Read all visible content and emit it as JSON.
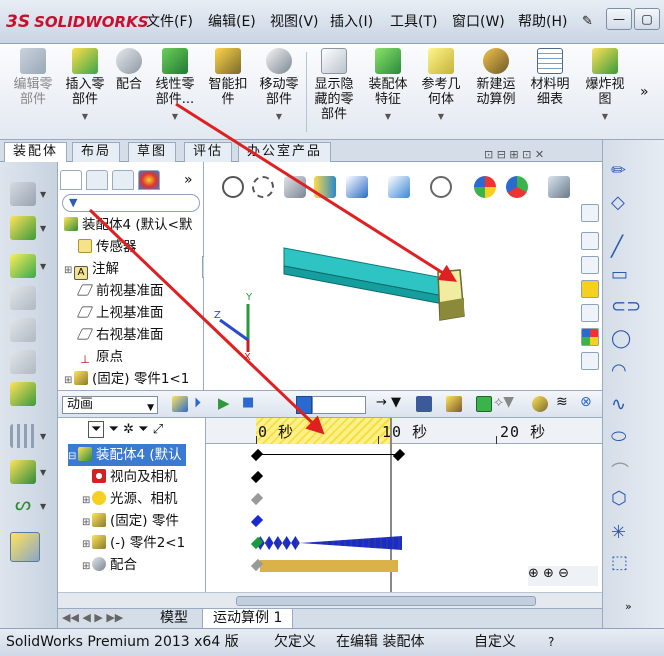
{
  "app": {
    "logo_prefix": "3S",
    "logo_text": "SOLIDWORKS"
  },
  "menu": {
    "items": [
      "文件(F)",
      "编辑(E)",
      "视图(V)",
      "插入(I)",
      "工具(T)",
      "窗口(W)",
      "帮助(H)"
    ]
  },
  "ribbon": {
    "buttons": [
      {
        "label": "编辑零\n部件",
        "icon": "edit-component-icon"
      },
      {
        "label": "插入零\n部件",
        "icon": "insert-component-icon"
      },
      {
        "label": "配合",
        "icon": "mate-icon"
      },
      {
        "label": "线性零\n部件...",
        "icon": "linear-pattern-icon"
      },
      {
        "label": "智能扣\n件",
        "icon": "smart-fastener-icon"
      },
      {
        "label": "移动零\n部件",
        "icon": "move-component-icon"
      },
      {
        "label": "显示隐\n藏的零\n部件",
        "icon": "show-hidden-icon"
      },
      {
        "label": "装配体\n特征",
        "icon": "assembly-feature-icon"
      },
      {
        "label": "参考几\n何体",
        "icon": "reference-geometry-icon"
      },
      {
        "label": "新建运\n动算例",
        "icon": "new-motion-study-icon"
      },
      {
        "label": "材料明\n细表",
        "icon": "bom-icon"
      },
      {
        "label": "爆炸视\n图",
        "icon": "exploded-view-icon"
      }
    ]
  },
  "tabs": [
    "装配体",
    "布局",
    "草图",
    "评估",
    "办公室产品"
  ],
  "feature_tree": {
    "nodes": [
      {
        "label": "装配体4  (默认<默",
        "icon": "assembly-icon"
      },
      {
        "label": "传感器",
        "icon": "sensor-icon"
      },
      {
        "label": "注解",
        "icon": "annotation-icon"
      },
      {
        "label": "前视基准面",
        "icon": "plane-icon"
      },
      {
        "label": "上视基准面",
        "icon": "plane-icon"
      },
      {
        "label": "右视基准面",
        "icon": "plane-icon"
      },
      {
        "label": "原点",
        "icon": "origin-icon"
      },
      {
        "label": "(固定) 零件1<1",
        "icon": "part-icon"
      }
    ]
  },
  "motion": {
    "study_type": "动画",
    "tree": [
      {
        "label": "装配体4  (默认",
        "icon": "assembly-icon"
      },
      {
        "label": "视向及相机",
        "icon": "camera-icon"
      },
      {
        "label": "光源、相机",
        "icon": "lights-icon"
      },
      {
        "label": "(固定) 零件",
        "icon": "part-icon"
      },
      {
        "label": "(-) 零件2<1",
        "icon": "part-icon"
      },
      {
        "label": "配合",
        "icon": "mate-icon"
      }
    ],
    "ruler": [
      "0 秒",
      "10 秒",
      "20 秒"
    ],
    "bottom_tabs": [
      "模型",
      "运动算例 1"
    ]
  },
  "status": {
    "product": "SolidWorks Premium 2013 x64 版",
    "state": "欠定义",
    "editing": "在编辑 装配体",
    "custom": "自定义"
  },
  "colors": {
    "accent": "#c8102e",
    "part_cyan": "#2ec4c4",
    "part_yellow": "#f2eca0",
    "hatch": "#f6df3c",
    "arrow": "#e02020"
  }
}
